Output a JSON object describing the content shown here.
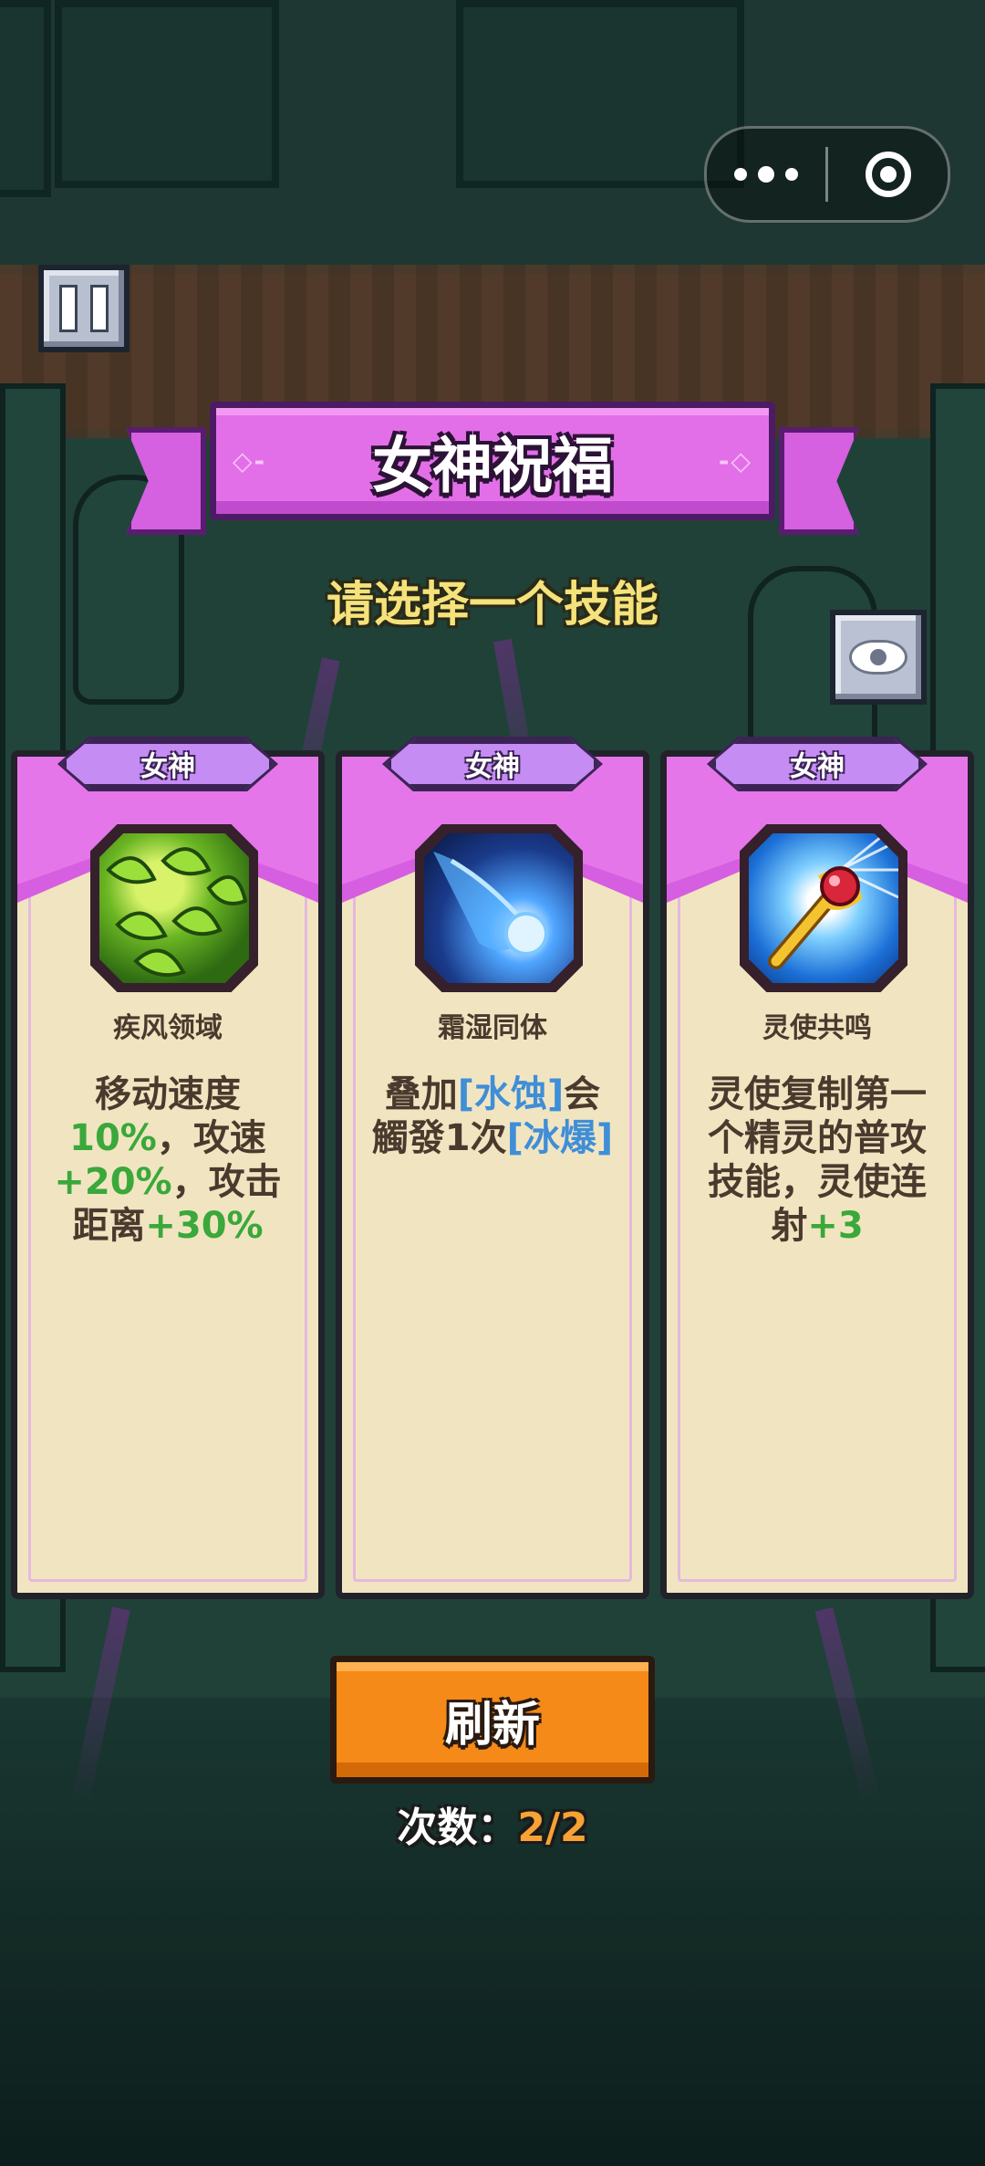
{
  "title": "女神祝福",
  "subtitle": "请选择一个技能",
  "capsule": {
    "menu_icon": "more-dots-icon",
    "close_icon": "target-circle-icon"
  },
  "pause": {
    "icon": "pause-icon"
  },
  "eye": {
    "icon": "eye-icon"
  },
  "cards": [
    {
      "tag": "女神",
      "name": "疾风领域",
      "icon": "wind-leaves-icon",
      "desc": [
        {
          "text": "移动速度",
          "style": "normal"
        },
        {
          "text": "10%",
          "style": "green"
        },
        {
          "text": "，攻速",
          "style": "normal"
        },
        {
          "text": "+20%",
          "style": "green"
        },
        {
          "text": "，攻击距离",
          "style": "normal"
        },
        {
          "text": "+30%",
          "style": "green"
        }
      ]
    },
    {
      "tag": "女神",
      "name": "霜湿同体",
      "icon": "frost-comet-icon",
      "desc": [
        {
          "text": "叠加",
          "style": "normal"
        },
        {
          "text": "[水蚀]",
          "style": "blue"
        },
        {
          "text": "会觸發1次",
          "style": "normal"
        },
        {
          "text": "[冰爆]",
          "style": "blue"
        }
      ]
    },
    {
      "tag": "女神",
      "name": "灵使共鸣",
      "icon": "golden-staff-icon",
      "desc": [
        {
          "text": "灵使复制第一个精灵的普攻技能，灵使连射",
          "style": "normal"
        },
        {
          "text": "+3",
          "style": "green"
        }
      ]
    }
  ],
  "refresh": {
    "label": "刷新"
  },
  "count": {
    "label": "次数：",
    "value": "2/2"
  },
  "colors": {
    "banner": "#e36fe8",
    "card_bg": "#f1e5c1",
    "tag": "#c58cf4",
    "refresh": "#f58a18",
    "green_text": "#3aa83a",
    "blue_text": "#3f8ed8",
    "count_value": "#f7a234",
    "subtitle": "#f5e27a"
  }
}
